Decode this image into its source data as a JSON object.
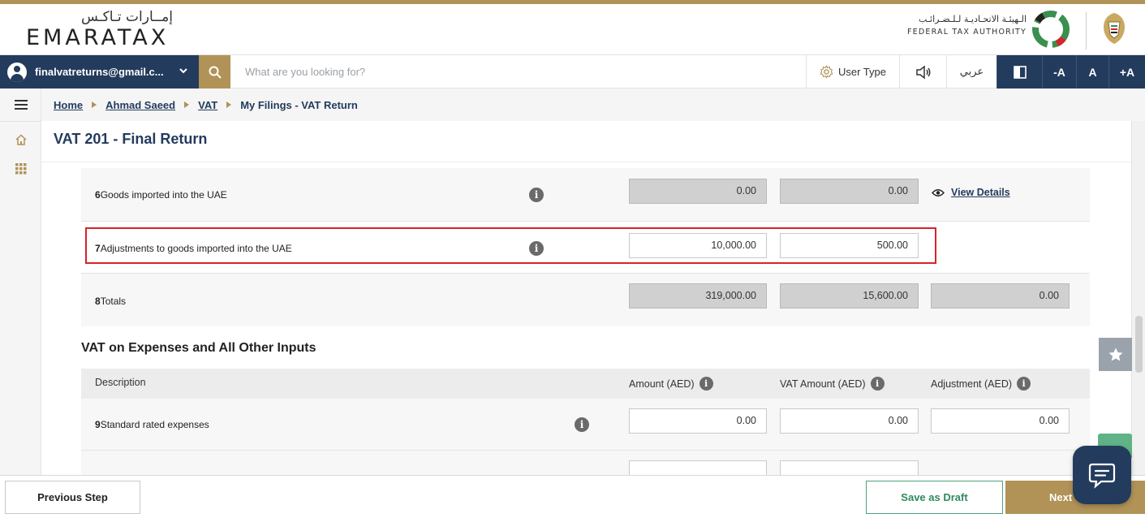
{
  "brand": {
    "logo_arabic": "إمــارات تـاكـس",
    "logo_english": "EMARATAX",
    "authority_arabic": "الـهيئـة الاتحـاديـة لـلـضـرائـب",
    "authority_english": "FEDERAL TAX AUTHORITY"
  },
  "toolbar": {
    "user_email": "finalvatreturns@gmail.c...",
    "search_placeholder": "What are you looking for?",
    "user_type_label": "User Type",
    "arabic_label": "عربي",
    "font_decrease_label": "-A",
    "font_normal_label": "A",
    "font_increase_label": "+A"
  },
  "breadcrumb": {
    "items": [
      "Home",
      "Ahmad Saeed",
      "VAT"
    ],
    "current": "My Filings - VAT Return"
  },
  "page": {
    "title": "VAT 201 - Final Return"
  },
  "sales_rows": [
    {
      "number": "6",
      "label": "Goods imported into the UAE",
      "amount": "0.00",
      "vat_amount": "0.00",
      "link": "View Details"
    },
    {
      "number": "7",
      "label": "Adjustments to goods imported into the UAE",
      "amount": "10,000.00",
      "vat_amount": "500.00"
    },
    {
      "number": "8",
      "label": "Totals",
      "amount": "319,000.00",
      "vat_amount": "15,600.00",
      "adjustment": "0.00"
    }
  ],
  "expenses_section": {
    "title": "VAT on Expenses and All Other Inputs",
    "columns": {
      "description": "Description",
      "amount": "Amount (AED)",
      "vat_amount": "VAT Amount (AED)",
      "adjustment": "Adjustment (AED)"
    },
    "rows": [
      {
        "number": "9",
        "label": "Standard rated expenses",
        "amount": "0.00",
        "vat_amount": "0.00",
        "adjustment": "0.00"
      }
    ]
  },
  "info_glyph": "i",
  "footer": {
    "previous_label": "Previous Step",
    "draft_label": "Save as Draft",
    "next_label": "Next"
  },
  "colors": {
    "navy": "#233b5d",
    "gold": "#b19257",
    "green": "#4fa27a",
    "highlight": "#d3252b"
  }
}
